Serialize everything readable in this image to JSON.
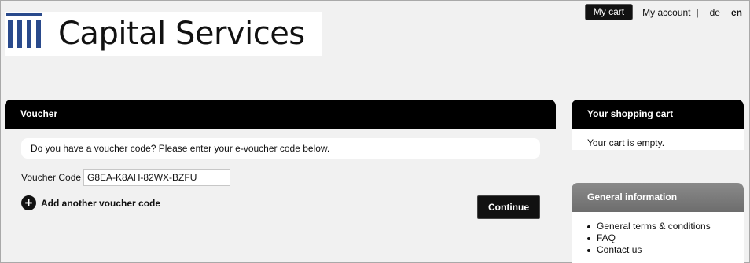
{
  "brand": {
    "name": "Capital Services",
    "colors": {
      "logo_mark": "#2a4a8c",
      "header_bg": "#000000",
      "page_bg": "#f1f1f1"
    }
  },
  "topnav": {
    "cart_label": "My cart",
    "account_label": "My account",
    "separator": "|",
    "lang_de": "de",
    "lang_en": "en",
    "active_lang": "en"
  },
  "voucher": {
    "title": "Voucher",
    "notice": "Do you have a voucher code? Please enter your e-voucher code below.",
    "code_label": "Voucher Code",
    "code_value": "G8EA-K8AH-82WX-BZFU",
    "add_label": "Add another voucher code",
    "add_icon": "plus-circle-icon",
    "continue_label": "Continue"
  },
  "cart": {
    "title": "Your shopping cart",
    "empty_text": "Your cart is empty."
  },
  "info": {
    "title": "General information",
    "links": [
      "General terms & conditions",
      "FAQ",
      "Contact us"
    ]
  }
}
